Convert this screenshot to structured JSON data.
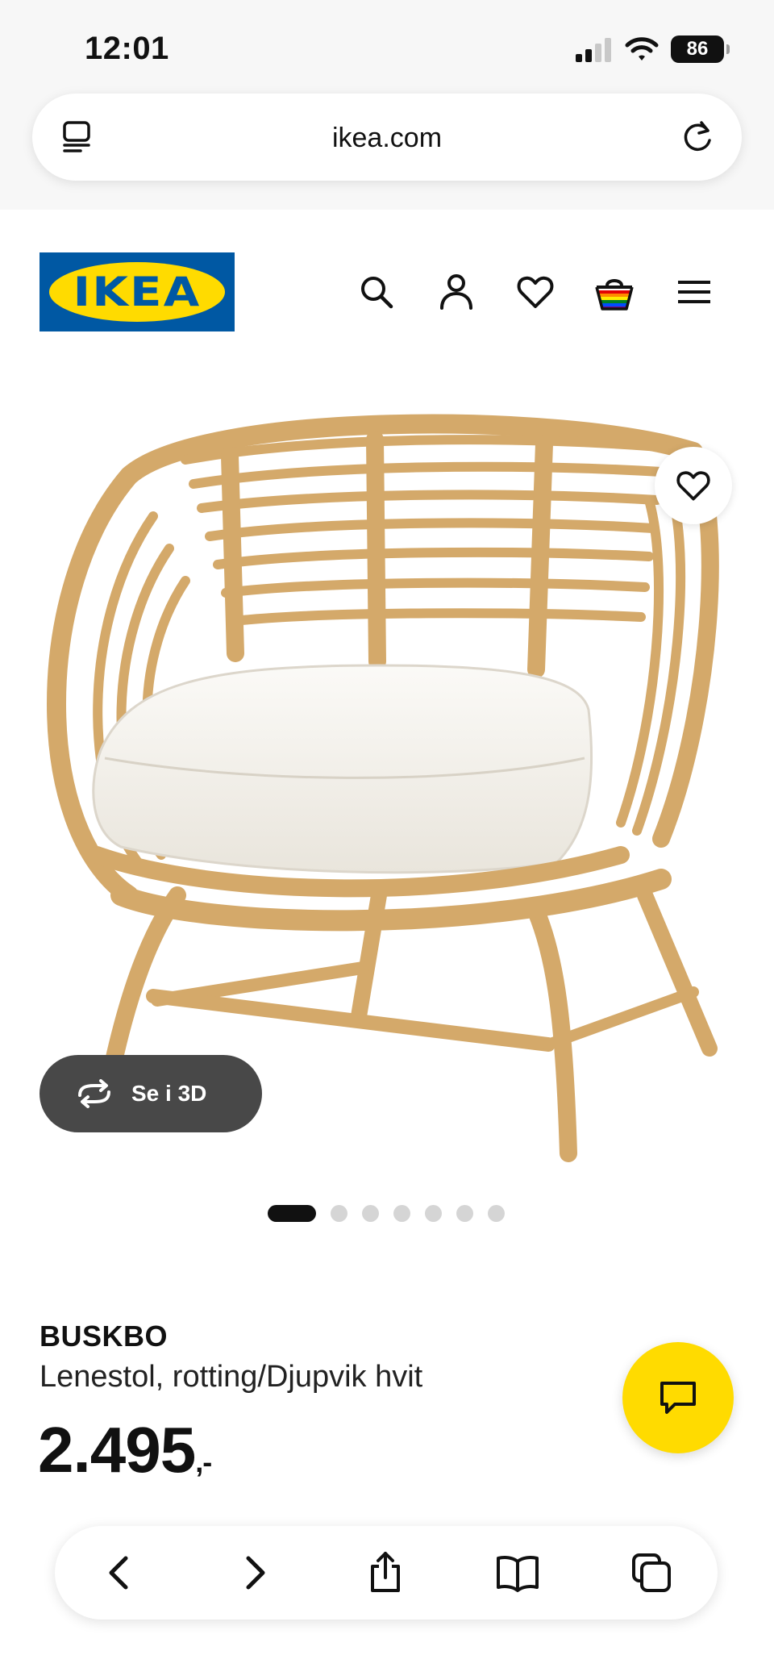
{
  "status_bar": {
    "time": "12:01",
    "battery": "86"
  },
  "browser": {
    "url": "ikea.com"
  },
  "header": {
    "logo_text": "IKEA"
  },
  "gallery": {
    "view_3d_label": "Se i 3D",
    "total_images": 7,
    "active_index": 0
  },
  "product": {
    "name": "BUSKBO",
    "description": "Lenestol, rotting/Djupvik hvit",
    "price_main": "2.495",
    "price_decimal": ",-"
  },
  "colors": {
    "ikea_blue": "#0058a3",
    "ikea_yellow": "#ffdb00",
    "view3d_bg": "#484848"
  }
}
